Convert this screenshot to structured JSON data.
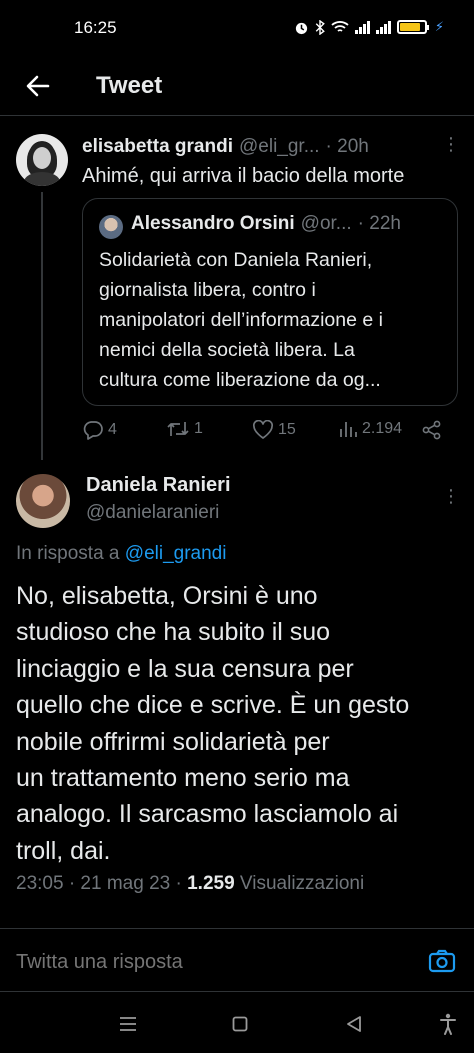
{
  "status": {
    "time": "16:25",
    "battery_color": "#f5c518",
    "icons": [
      "alarm-icon",
      "bluetooth-icon",
      "wifi-icon",
      "signal-icon",
      "battery-icon",
      "charging-icon"
    ]
  },
  "header": {
    "title": "Tweet"
  },
  "tweet1": {
    "name": "elisabetta grandi",
    "handle": "@eli_gr...",
    "time": "· 20h",
    "text": "Ahimé, qui arriva il bacio della morte",
    "quote": {
      "name": "Alessandro Orsini",
      "handle": "@or...",
      "time": "· 22h",
      "lines": [
        "Solidarietà con Daniela Ranieri,",
        "giornalista libera, contro i",
        "manipolatori dell’informazione e i",
        "nemici della società libera. La",
        "cultura come liberazione da og..."
      ]
    },
    "actions": {
      "replies": "4",
      "retweets": "1",
      "likes": "15",
      "views": "2.194"
    }
  },
  "tweet2": {
    "name": "Daniela Ranieri",
    "handle": "@danielaranieri",
    "reply_prefix": "In risposta a ",
    "reply_handle": "@eli_grandi",
    "lines": [
      "No, elisabetta, Orsini è uno",
      "studioso che ha subito il suo",
      "linciaggio e la sua censura per",
      "quello che dice e scrive. È un gesto",
      "nobile offrirmi solidarietà per",
      "un trattamento meno serio ma",
      "analogo. Il sarcasmo lasciamolo ai",
      "troll, dai."
    ],
    "meta_time": "23:05 · 21 mag 23 · ",
    "views_count": "1.259",
    "views_label": " Visualizzazioni"
  },
  "composer": {
    "placeholder": "Twitta una risposta"
  },
  "colors": {
    "accent": "#1d9bf0",
    "muted": "#71767b",
    "text": "#e7e9ea",
    "background": "#000000"
  }
}
